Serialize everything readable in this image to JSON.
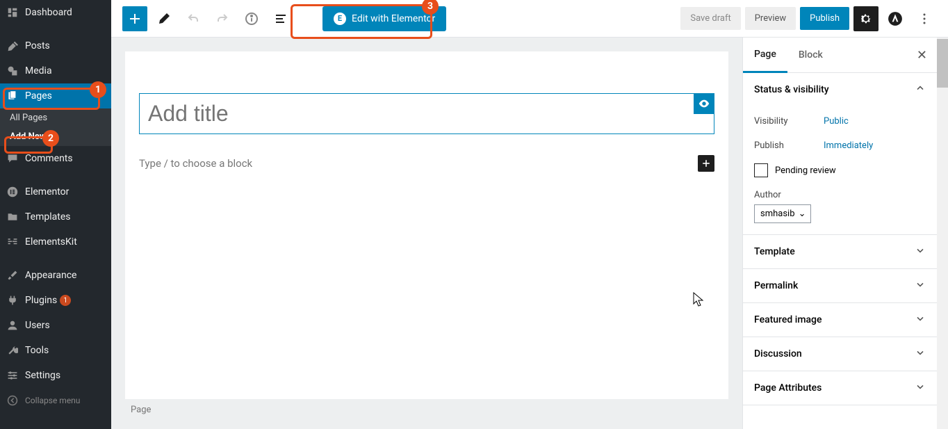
{
  "annotations": {
    "pages_num": "1",
    "addnew_num": "2",
    "elementor_num": "3"
  },
  "sidebar": {
    "dashboard": "Dashboard",
    "posts": "Posts",
    "media": "Media",
    "pages": "Pages",
    "all_pages": "All Pages",
    "add_new": "Add New",
    "comments": "Comments",
    "elementor": "Elementor",
    "templates": "Templates",
    "elementskit": "ElementsKit",
    "appearance": "Appearance",
    "plugins": "Plugins",
    "plugins_badge": "1",
    "users": "Users",
    "tools": "Tools",
    "settings": "Settings",
    "collapse": "Collapse menu"
  },
  "topbar": {
    "elementor_btn": "Edit with Elementor",
    "save_draft": "Save draft",
    "preview": "Preview",
    "publish": "Publish"
  },
  "editor": {
    "title_placeholder": "Add title",
    "block_placeholder": "Type / to choose a block",
    "footer_tag": "Page"
  },
  "settings_panel": {
    "tab_page": "Page",
    "tab_block": "Block",
    "status_visibility": "Status & visibility",
    "visibility_label": "Visibility",
    "visibility_value": "Public",
    "publish_label": "Publish",
    "publish_value": "Immediately",
    "pending_review": "Pending review",
    "author_label": "Author",
    "author_value": "smhasib",
    "template": "Template",
    "permalink": "Permalink",
    "featured_image": "Featured image",
    "discussion": "Discussion",
    "page_attributes": "Page Attributes"
  }
}
